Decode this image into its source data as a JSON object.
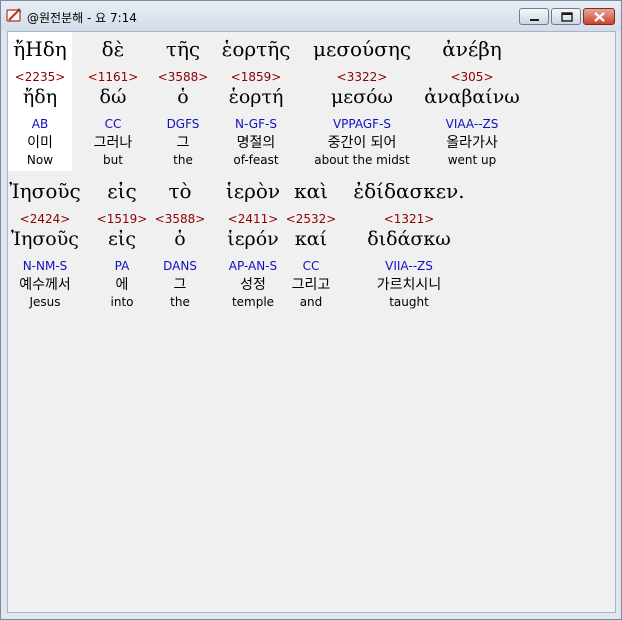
{
  "window": {
    "title": "@원전분해 - 요 7:14"
  },
  "colors": {
    "strongs": "#8b0000",
    "parse": "#1010c0",
    "highlight": "#ffffff"
  },
  "icons": {
    "app": "bible-pencil-icon",
    "minimize": "minimize-icon",
    "maximize": "maximize-icon",
    "close": "close-icon"
  },
  "rows": [
    {
      "words": [
        {
          "greek": "ἤΗδη",
          "strongs": "<2235>",
          "lemma": "ἤδη",
          "parse": "AB",
          "korean": "이미",
          "english": "Now"
        },
        {
          "greek": "δὲ",
          "strongs": "<1161>",
          "lemma": "δώ",
          "parse": "CC",
          "korean": "그러나",
          "english": "but"
        },
        {
          "greek": "τῆς",
          "strongs": "<3588>",
          "lemma": "ὁ",
          "parse": "DGFS",
          "korean": "그",
          "english": "the"
        },
        {
          "greek": "ἑορτῆς",
          "strongs": "<1859>",
          "lemma": "ἑορτή",
          "parse": "N-GF-S",
          "korean": "명절의",
          "english": "of-feast"
        },
        {
          "greek": "μεσούσης",
          "strongs": "<3322>",
          "lemma": "μεσόω",
          "parse": "VPPAGF-S",
          "korean": "중간이 되어",
          "english": "about the midst"
        },
        {
          "greek": "ἀνέβη",
          "strongs": "<305>",
          "lemma": "ἀναβαίνω",
          "parse": "VIAA--ZS",
          "korean": "올라가사",
          "english": "went up"
        }
      ]
    },
    {
      "words": [
        {
          "greek": "Ἰησοῦς",
          "strongs": "<2424>",
          "lemma": "Ἰησοῦς",
          "parse": "N-NM-S",
          "korean": "예수께서",
          "english": "Jesus"
        },
        {
          "greek": "εἰς",
          "strongs": "<1519>",
          "lemma": "εἰς",
          "parse": "PA",
          "korean": "에",
          "english": "into"
        },
        {
          "greek": "τὸ",
          "strongs": "<3588>",
          "lemma": "ὁ",
          "parse": "DANS",
          "korean": "그",
          "english": "the"
        },
        {
          "greek": "ἱερὸν",
          "strongs": "<2411>",
          "lemma": "ἱερόν",
          "parse": "AP-AN-S",
          "korean": "성정",
          "english": "temple"
        },
        {
          "greek": "καὶ",
          "strongs": "<2532>",
          "lemma": "καί",
          "parse": "CC",
          "korean": "그리고",
          "english": "and"
        },
        {
          "greek": "ἐδίδασκεν.",
          "strongs": "<1321>",
          "lemma": "διδάσκω",
          "parse": "VIIA--ZS",
          "korean": "가르치시니",
          "english": "taught"
        }
      ]
    }
  ]
}
